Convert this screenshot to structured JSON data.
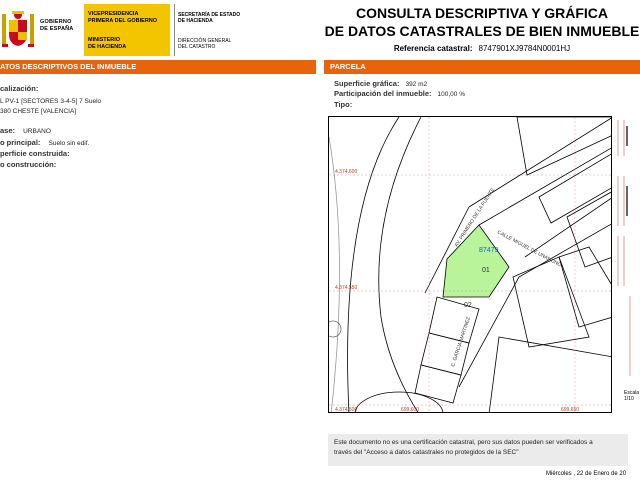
{
  "header": {
    "gov_line1": "GOBIERNO",
    "gov_line2": "DE ESPAÑA",
    "vice_line1": "VICEPRESIDENCIA",
    "vice_line2": "PRIMERA DEL GOBIERNO",
    "min_line1": "MINISTERIO",
    "min_line2": "DE HACIENDA",
    "sec_line1": "SECRETARÍA DE ESTADO",
    "sec_line2": "DE HACIENDA",
    "dir_line1": "DIRECCIÓN GENERAL",
    "dir_line2": "DEL CATASTRO",
    "title_line1": "CONSULTA DESCRIPTIVA Y GRÁFICA",
    "title_line2": "DE DATOS CATASTRALES DE BIEN INMUEBLE",
    "refcat_label": "Referencia catastral:",
    "refcat_value": "8747901XJ9784N0001HJ"
  },
  "left": {
    "bar_title": "ATOS DESCRIPTIVOS DEL INMUEBLE",
    "loc_label": "calización:",
    "loc_line1": "L PV-1 [SECTORES 3-4-5] 7 Suelo",
    "loc_line2": "380 CHESTE [VALENCIA]",
    "class_label": "ase:",
    "class_value": "URBANO",
    "use_label": "o principal:",
    "use_value": "Suelo sin edif.",
    "built_label": "perficie construida:",
    "year_label": "o construcción:"
  },
  "right": {
    "bar_title": "PARCELA",
    "surface_label": "Superficie gráfica:",
    "surface_value": "392 m2",
    "part_label": "Participación del inmueble:",
    "part_value": "100,00 %",
    "type_label": "Tipo:"
  },
  "map": {
    "parcel_id": "87479",
    "plot_01": "01",
    "plot_02": "02",
    "street_1": "AV. PRIMERO DE LA FUENTE",
    "street_2": "CALLE MIGUEL DE UNAMUNO",
    "street_3": "C. GARCIA MARTINEZ",
    "coord_y1": "4.374.600",
    "coord_y2": "4.374.550",
    "coord_y3": "4.374.500",
    "coord_x1": "699.600",
    "coord_x2": "699.650",
    "scale_text": "Escala 1/10"
  },
  "footer": {
    "disclaimer_line1": "Este documento no es una certificación catastral, pero sus datos pueden ser verificados a",
    "disclaimer_line2": "través del \"Acceso a datos catastrales no protegidos de la SEC\"",
    "date": "Miércoles , 22 de Enero de 20"
  },
  "colors": {
    "accent": "#e8630a",
    "yellow": "#f3c500",
    "parcel_fill": "#b9f39a",
    "coord_red": "#c0392b"
  }
}
